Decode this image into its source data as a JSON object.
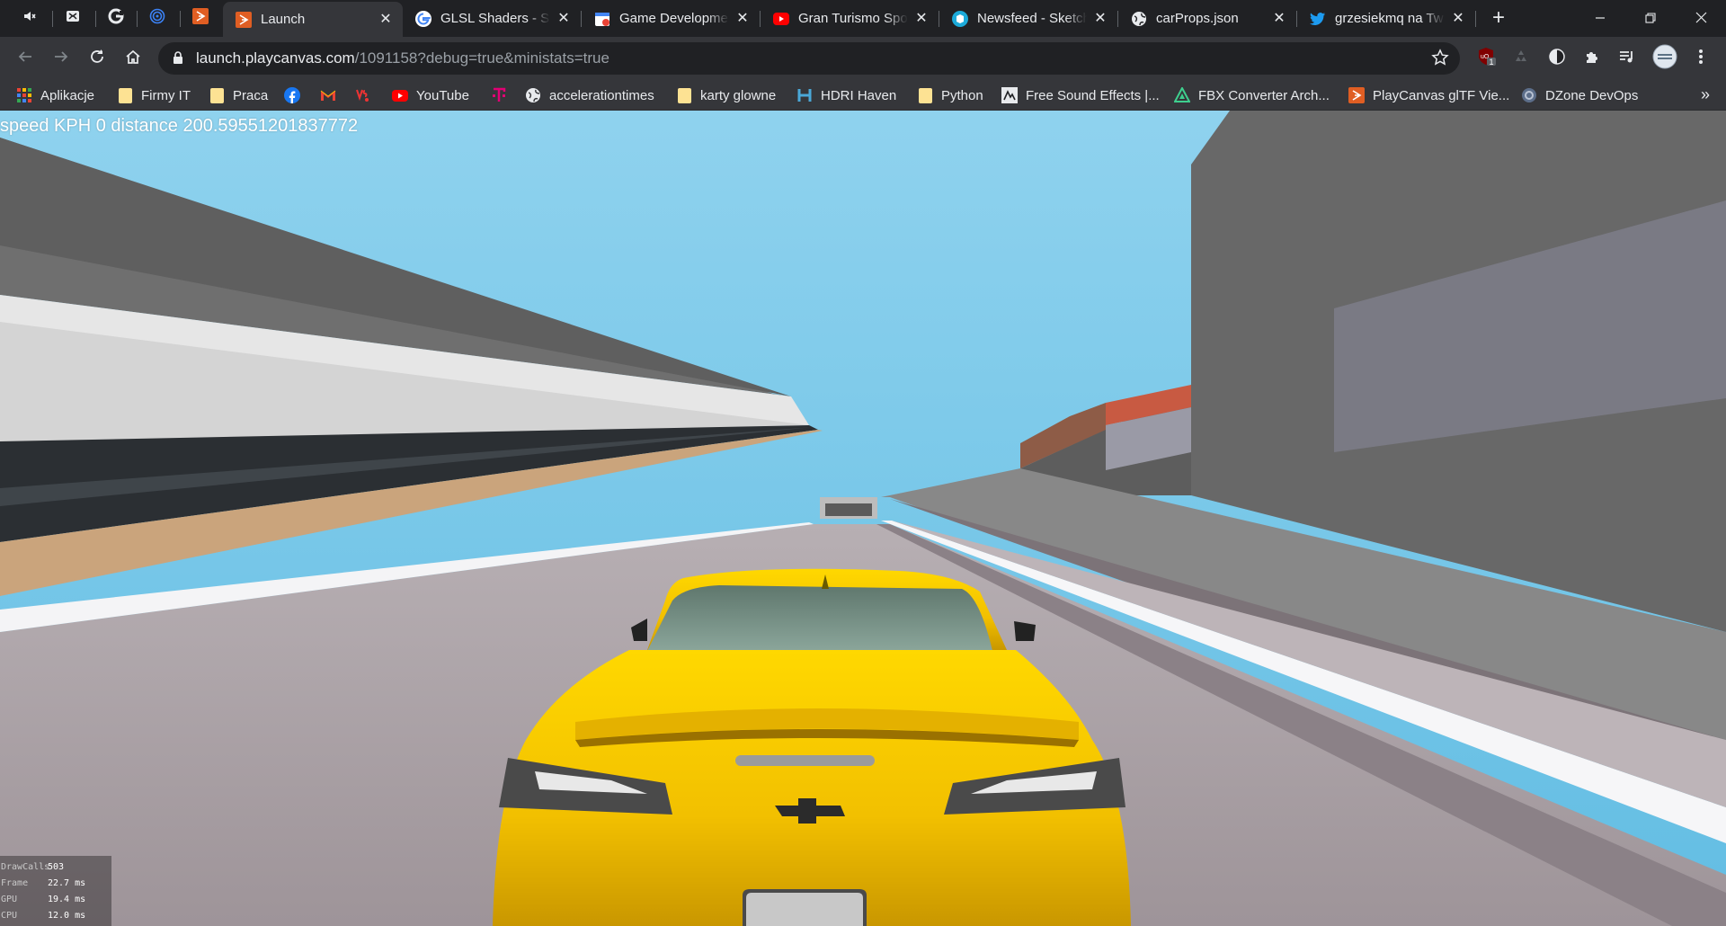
{
  "browser": {
    "pinned_tabs": [
      {
        "icon": "mute-icon"
      },
      {
        "icon": "mail-icon"
      },
      {
        "icon": "google-icon"
      },
      {
        "icon": "target-icon"
      },
      {
        "icon": "playcanvas-icon"
      }
    ],
    "tabs": [
      {
        "title": "Launch",
        "icon": "playcanvas-icon",
        "active": true
      },
      {
        "title": "GLSL Shaders - Sz",
        "icon": "google-icon",
        "active": false
      },
      {
        "title": "Game Developme",
        "icon": "calendar-icon",
        "active": false
      },
      {
        "title": "Gran Turismo Spo",
        "icon": "youtube-icon",
        "active": false
      },
      {
        "title": "Newsfeed - Sketch",
        "icon": "sketchfab-icon",
        "active": false
      },
      {
        "title": "carProps.json",
        "icon": "globe-icon",
        "active": false
      },
      {
        "title": "grzesiekmq na Tw",
        "icon": "twitter-icon",
        "active": false
      }
    ],
    "close_glyph": "✕",
    "new_tab_glyph": "+"
  },
  "toolbar": {
    "url_host": "launch.playcanvas.com",
    "url_path": "/1091158?debug=true&ministats=true",
    "extension_badge": "1"
  },
  "bookmarks": [
    {
      "label": "Aplikacje",
      "icon": "apps-grid-icon"
    },
    {
      "label": "Firmy IT",
      "icon": "folder-icon"
    },
    {
      "label": "Praca",
      "icon": "folder-icon"
    },
    {
      "label": "",
      "icon": "facebook-icon"
    },
    {
      "label": "",
      "icon": "gmail-icon"
    },
    {
      "label": "",
      "icon": "vs-icon"
    },
    {
      "label": "YouTube",
      "icon": "youtube-icon"
    },
    {
      "label": "",
      "icon": "tmobile-icon"
    },
    {
      "label": "accelerationtimes",
      "icon": "globe-icon"
    },
    {
      "label": "karty glowne",
      "icon": "folder-icon"
    },
    {
      "label": "HDRI Haven",
      "icon": "hdri-icon"
    },
    {
      "label": "Python",
      "icon": "folder-icon"
    },
    {
      "label": "Free Sound Effects |...",
      "icon": "sound-icon"
    },
    {
      "label": "FBX Converter Arch...",
      "icon": "fbx-icon"
    },
    {
      "label": "PlayCanvas glTF Vie...",
      "icon": "playcanvas-icon"
    },
    {
      "label": "DZone DevOps",
      "icon": "dzone-icon"
    }
  ],
  "bookmarks_more": "»",
  "game": {
    "hud_text": "speed KPH 0 distance 200.59551201837772",
    "ministats": [
      {
        "label": "DrawCalls",
        "value": "503"
      },
      {
        "label": "Frame",
        "value": "22.7 ms"
      },
      {
        "label": "GPU",
        "value": "19.4 ms"
      },
      {
        "label": "CPU",
        "value": "12.0 ms"
      }
    ],
    "car_colors": {
      "body": "#f5c800",
      "shadow": "#c79600",
      "glass": "#6f8a80"
    },
    "sky_color": "#6fc4e6",
    "road_color": "#a79ca0"
  }
}
